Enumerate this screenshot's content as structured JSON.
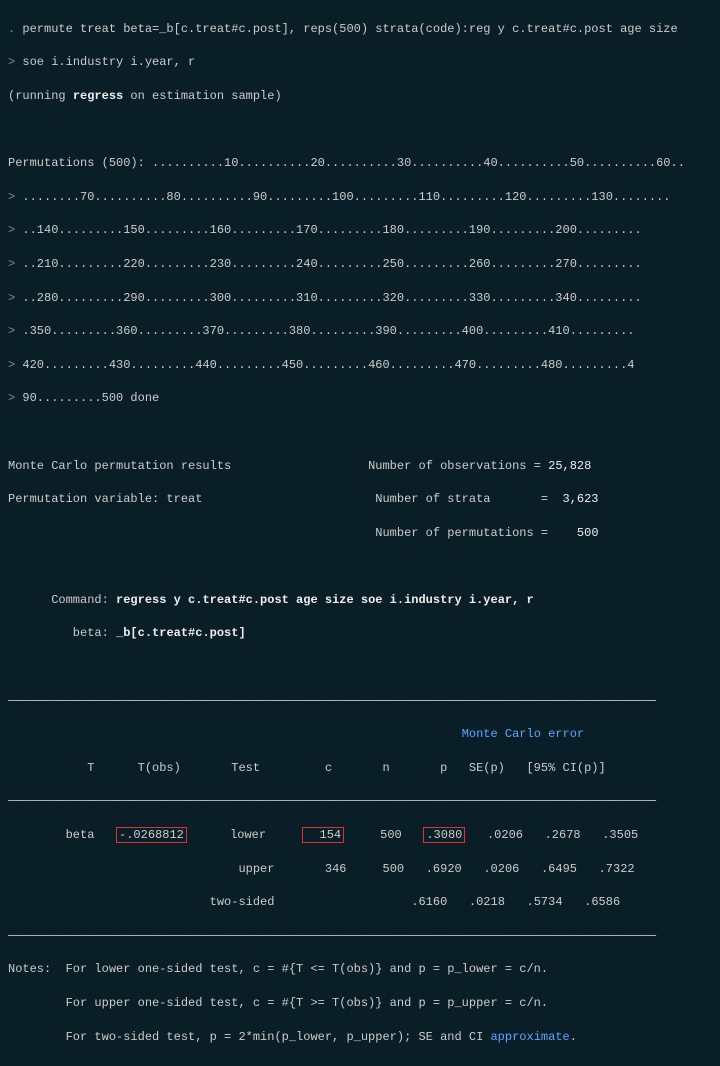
{
  "cmd": {
    "line1": "permute treat beta=_b[c.treat#c.post], reps(500) strata(code):reg y c.treat#c.post age size",
    "line2": "soe i.industry i.year, r"
  },
  "run": {
    "cmd": "regress"
  },
  "progress": {
    "0": "Permutations (500): ..........10..........20..........30..........40..........50..........60..",
    "1": "........70..........80..........90.........100.........110.........120.........130........",
    "2": "..140.........150.........160.........170.........180.........190.........200.........",
    "3": "..210.........220.........230.........240.........250.........260.........270.........",
    "4": "..280.........290.........300.........310.........320.........330.........340.........",
    "5": ".350.........360.........370.........380.........390.........400.........410.........",
    "6": "420.........430.........440.........450.........460.........470.........480.........4",
    "7": "90.........500 done"
  },
  "hdr": {
    "left1": "Monte Carlo permutation results",
    "r1l": "Number of observations",
    "r1v": "25,828",
    "left2": "Permutation variable: treat",
    "r2l": "Number of strata",
    "r2v": "3,623",
    "r3l": "Number of permutations",
    "r3v": "500"
  },
  "meta": {
    "command": "regress y c.treat#c.post age size soe i.industry i.year, r",
    "beta": "_b[c.treat#c.post]"
  },
  "table": {
    "mc_label": "Monte Carlo error",
    "rows": [
      {
        "name": "beta",
        "tobs": "-.0268812",
        "test": "lower",
        "c": "154",
        "n": "500",
        "p": ".3080",
        "se": ".0206",
        "cil": ".2678",
        "ciu": ".3505"
      },
      {
        "name": "",
        "tobs": "",
        "test": "upper",
        "c": "346",
        "n": "500",
        "p": ".6920",
        "se": ".0206",
        "cil": ".6495",
        "ciu": ".7322"
      },
      {
        "name": "",
        "tobs": "",
        "test": "two-sided",
        "c": "",
        "n": "",
        "p": ".6160",
        "se": ".0218",
        "cil": ".5734",
        "ciu": ".6586"
      }
    ]
  },
  "notes": [
    "Notes:  For lower one-sided test, c = #{T <= T(obs)} and p = p_lower = c/n.",
    "        For upper one-sided test, c = #{T >= T(obs)} and p = p_upper = c/n."
  ],
  "notes_approx": "approximate"
}
